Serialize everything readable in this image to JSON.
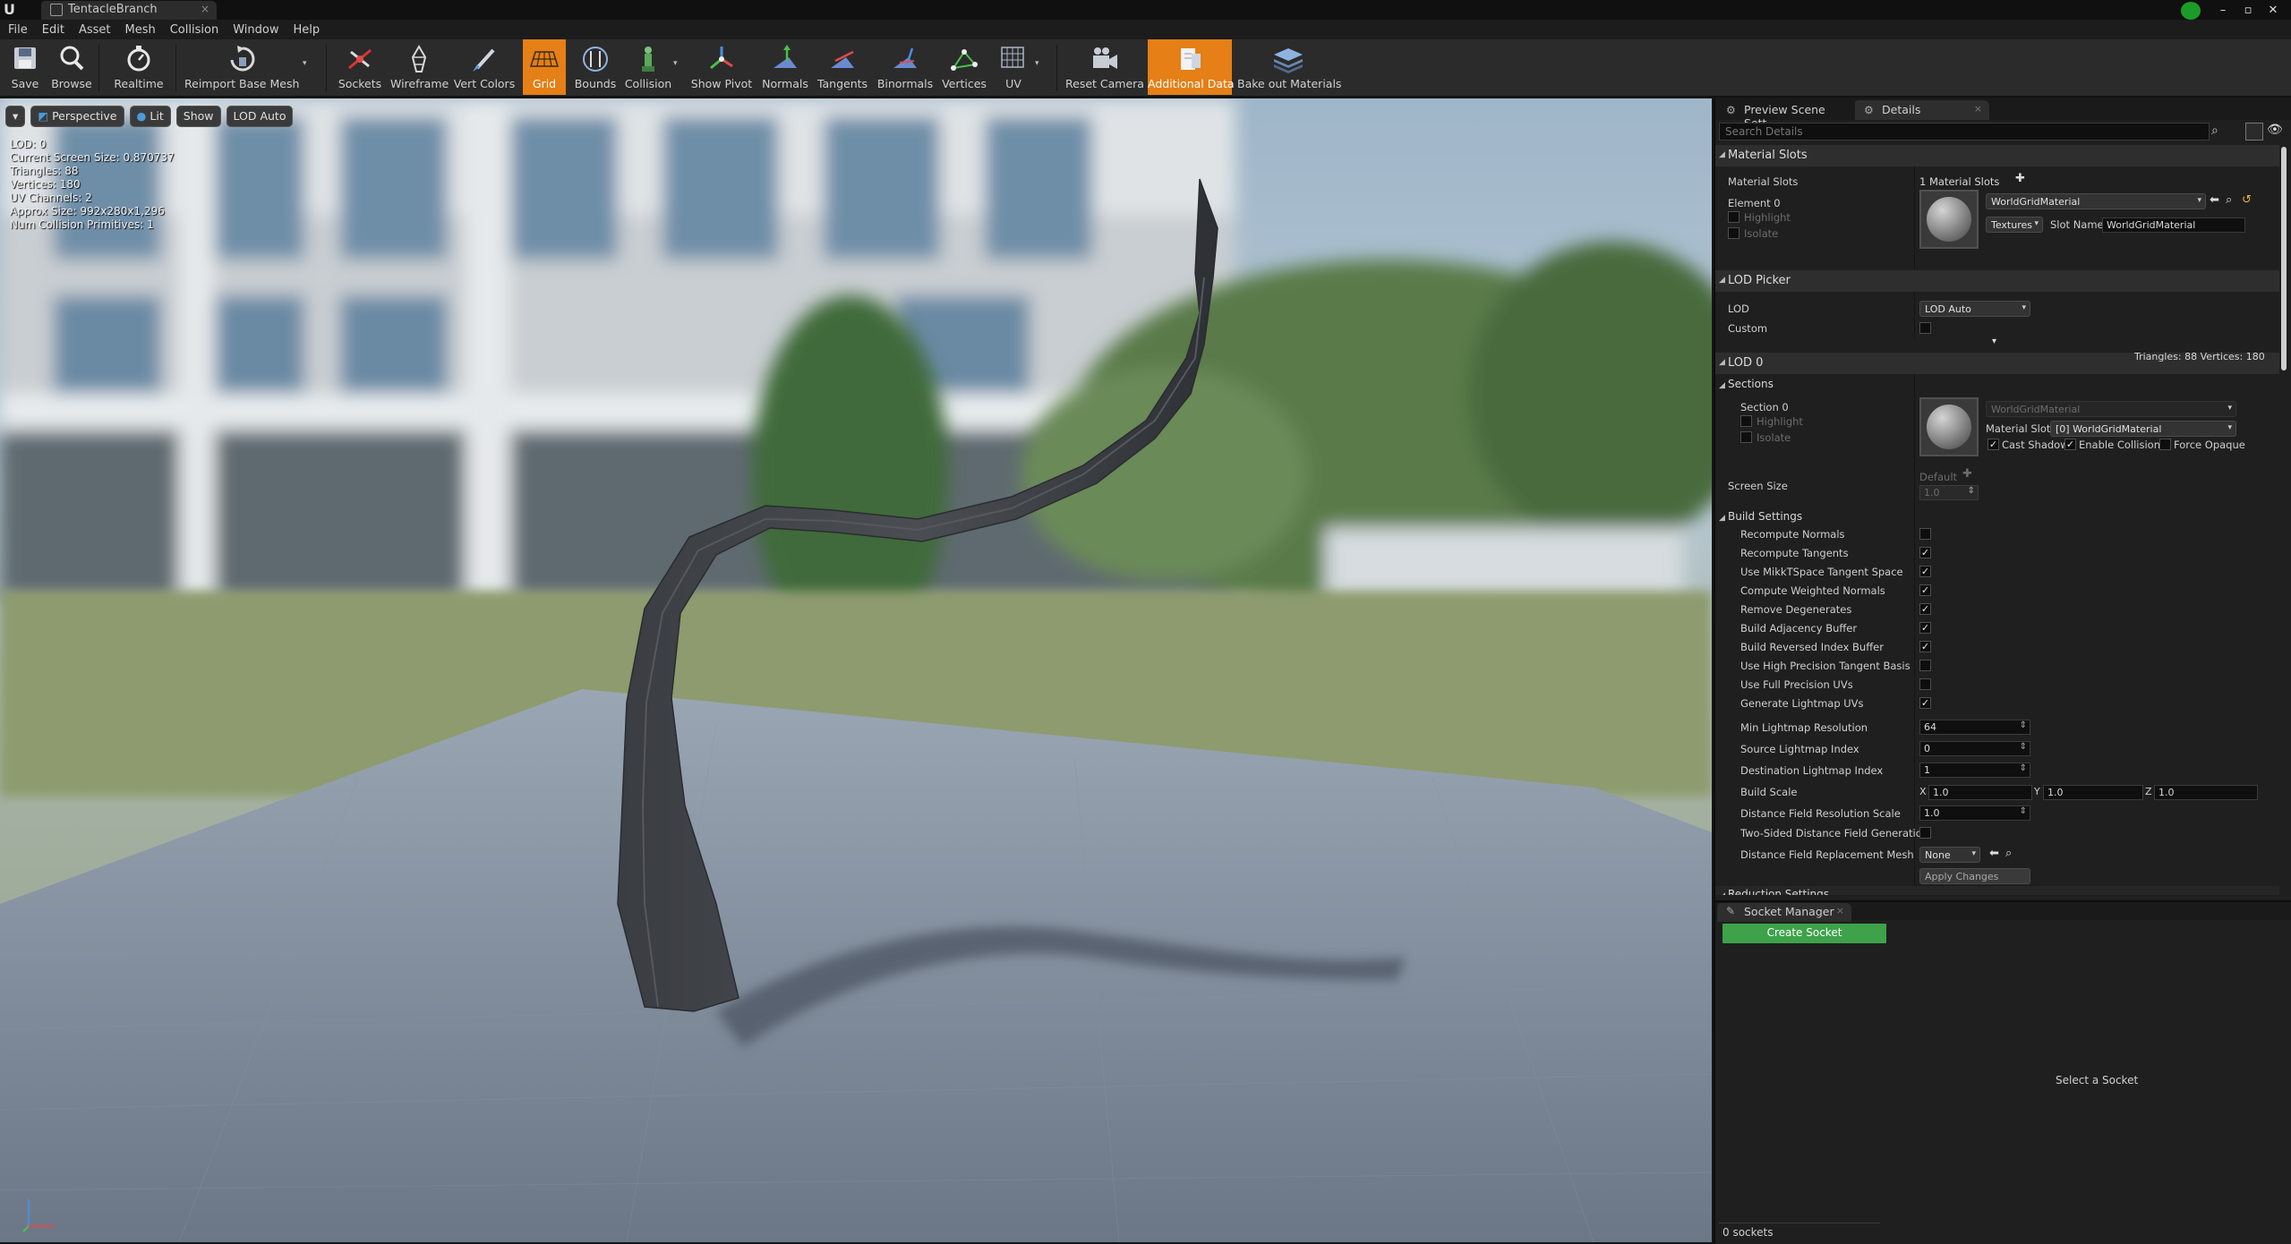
{
  "window": {
    "tab_title": "TentacleBranch",
    "tab_close": "×",
    "controls": [
      "–",
      "▫",
      "✕"
    ]
  },
  "menu": [
    "File",
    "Edit",
    "Asset",
    "Mesh",
    "Collision",
    "Window",
    "Help"
  ],
  "toolbar": {
    "save": "Save",
    "browse": "Browse",
    "realtime": "Realtime",
    "reimport": "Reimport Base Mesh",
    "sockets": "Sockets",
    "wireframe": "Wireframe",
    "vert_colors": "Vert Colors",
    "grid": "Grid",
    "bounds": "Bounds",
    "collision": "Collision",
    "show_pivot": "Show Pivot",
    "normals": "Normals",
    "tangents": "Tangents",
    "binormals": "Binormals",
    "vertices": "Vertices",
    "uv": "UV",
    "reset_camera": "Reset Camera",
    "additional_data": "Additional Data",
    "bake_out": "Bake out Materials",
    "accent": "#e57f16"
  },
  "viewport": {
    "perspective": "Perspective",
    "lit": "Lit",
    "show": "Show",
    "lod_auto": "LOD Auto",
    "stats": [
      "LOD:  0",
      "Current Screen Size:  0.870737",
      "Triangles:  88",
      "Vertices:  180",
      "UV Channels:  2",
      "Approx Size: 992x280x1,296",
      "Num Collision Primitives:  1"
    ]
  },
  "panel": {
    "tab_preview": "Preview Scene Sett",
    "tab_details": "Details",
    "search_placeholder": "Search Details",
    "material_slots": {
      "header": "Material Slots",
      "label": "Material Slots",
      "count": "1 Material Slots",
      "element": "Element 0",
      "highlight": "Highlight",
      "isolate": "Isolate",
      "material": "WorldGridMaterial",
      "textures": "Textures",
      "slot_name_label": "Slot Name",
      "slot_name": "WorldGridMaterial"
    },
    "lod_picker": {
      "header": "LOD Picker",
      "lod_label": "LOD",
      "lod_value": "LOD Auto",
      "custom_label": "Custom"
    },
    "lod0": {
      "header": "LOD 0",
      "stats": "Triangles: 88   Vertices: 180",
      "sections_header": "Sections",
      "section": "Section 0",
      "highlight": "Highlight",
      "isolate": "Isolate",
      "material": "WorldGridMaterial",
      "material_slot_label": "Material Slot",
      "material_slot": "[0] WorldGridMaterial",
      "cast_shadow": "Cast Shadow",
      "enable_collision": "Enable Collision",
      "force_opaque": "Force Opaque",
      "screen_size_label": "Screen Size",
      "screen_size_default": "Default",
      "screen_size_value": "1.0"
    },
    "build_settings": {
      "header": "Build Settings",
      "checks": [
        {
          "label": "Recompute Normals",
          "checked": false
        },
        {
          "label": "Recompute Tangents",
          "checked": true
        },
        {
          "label": "Use MikkTSpace Tangent Space",
          "checked": true
        },
        {
          "label": "Compute Weighted Normals",
          "checked": true
        },
        {
          "label": "Remove Degenerates",
          "checked": true
        },
        {
          "label": "Build Adjacency Buffer",
          "checked": true
        },
        {
          "label": "Build Reversed Index Buffer",
          "checked": true
        },
        {
          "label": "Use High Precision Tangent Basis",
          "checked": false
        },
        {
          "label": "Use Full Precision UVs",
          "checked": false
        },
        {
          "label": "Generate Lightmap UVs",
          "checked": true
        }
      ],
      "min_lightmap_label": "Min Lightmap Resolution",
      "min_lightmap": "64",
      "source_lightmap_label": "Source Lightmap Index",
      "source_lightmap": "0",
      "dest_lightmap_label": "Destination Lightmap Index",
      "dest_lightmap": "1",
      "build_scale_label": "Build Scale",
      "build_scale": {
        "x": "1.0",
        "y": "1.0",
        "z": "1.0"
      },
      "df_res_label": "Distance Field Resolution Scale",
      "df_res": "1.0",
      "two_sided_label": "Two-Sided Distance Field Generation",
      "df_replacement_label": "Distance Field Replacement Mesh",
      "df_replacement": "None",
      "apply": "Apply Changes"
    },
    "reduction_header": "Reduction Settings",
    "socket_manager": {
      "tab": "Socket Manager",
      "create": "Create Socket",
      "select": "Select a Socket",
      "count": "0 sockets"
    }
  }
}
